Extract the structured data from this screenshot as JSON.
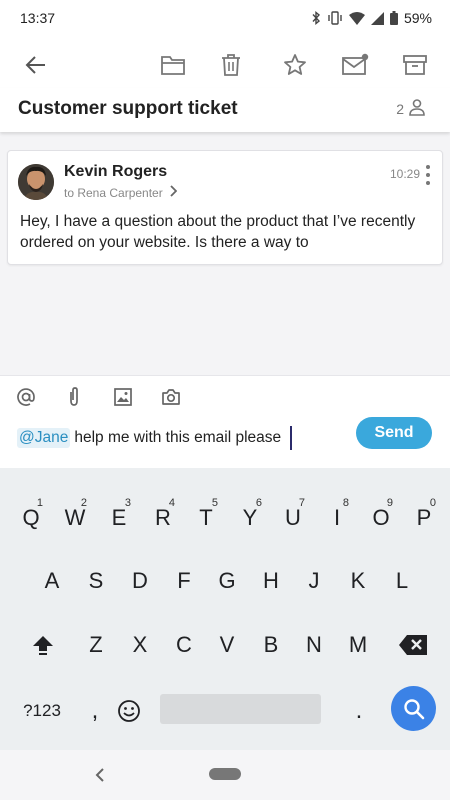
{
  "status_bar": {
    "time": "13:37",
    "battery": "59%",
    "icons": [
      "bluetooth-icon",
      "vibrate-icon",
      "wifi-icon",
      "signal-icon",
      "battery-icon"
    ]
  },
  "toolbar": {
    "icons": [
      "back-arrow-icon",
      "folder-icon",
      "trash-icon",
      "star-icon",
      "mark-unread-icon",
      "archive-icon"
    ]
  },
  "ticket": {
    "subject": "Customer support ticket",
    "participants_count": "2"
  },
  "message": {
    "sender": "Kevin Rogers",
    "recipient": "to Rena Carpenter",
    "time": "10:29",
    "body": "Hey,  I have a question about the product that I’ve recently ordered on your website. Is there a way to"
  },
  "composer": {
    "mention": "@Jane",
    "text": "help me with this email please",
    "send_label": "Send",
    "icons": [
      "at-icon",
      "paperclip-icon",
      "image-icon",
      "camera-icon"
    ]
  },
  "keyboard": {
    "row1": [
      {
        "label": "Q",
        "hint": "1"
      },
      {
        "label": "W",
        "hint": "2"
      },
      {
        "label": "E",
        "hint": "3"
      },
      {
        "label": "R",
        "hint": "4"
      },
      {
        "label": "T",
        "hint": "5"
      },
      {
        "label": "Y",
        "hint": "6"
      },
      {
        "label": "U",
        "hint": "7"
      },
      {
        "label": "I",
        "hint": "8"
      },
      {
        "label": "O",
        "hint": "9"
      },
      {
        "label": "P",
        "hint": "0"
      }
    ],
    "row2": [
      "A",
      "S",
      "D",
      "F",
      "G",
      "H",
      "J",
      "K",
      "L"
    ],
    "row3": [
      "Z",
      "X",
      "C",
      "V",
      "B",
      "N",
      "M"
    ],
    "symbols_label": "?123",
    "comma_label": ",",
    "period_label": ".",
    "icons": [
      "shift-icon",
      "backspace-icon",
      "emoji-icon",
      "search-icon"
    ]
  },
  "nav_bar": {
    "icons": [
      "nav-back-icon",
      "home-pill-icon"
    ]
  }
}
